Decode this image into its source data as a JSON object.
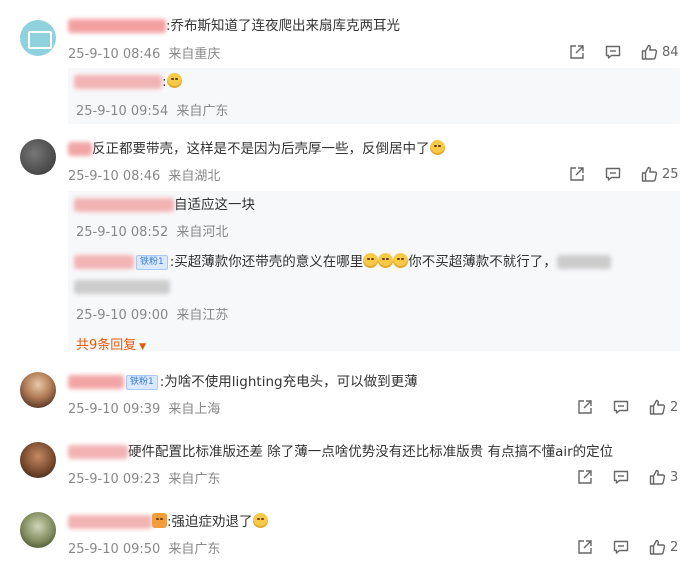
{
  "comments": [
    {
      "text": ":乔布斯知道了连夜爬出来扇库克两耳光",
      "time": "25-9-10 08:46",
      "location": "来自重庆",
      "likes": "84"
    },
    {
      "text": "反正都要带壳，这样是不是因为后壳厚一些，反倒居中了",
      "time": "25-9-10 08:46",
      "location": "来自湖北",
      "likes": "25"
    },
    {
      "badge": "铁粉1",
      "text": ":为啥不使用lighting充电头，可以做到更薄",
      "time": "25-9-10 09:39",
      "location": "来自上海",
      "likes": "2"
    },
    {
      "text": "硬件配置比标准版还差 除了薄一点啥优势没有还比标准版贵 有点搞不懂air的定位",
      "time": "25-9-10 09:23",
      "location": "来自广东",
      "likes": "3"
    },
    {
      "text": ":强迫症劝退了",
      "time": "25-9-10 09:50",
      "location": "来自广东",
      "likes": "2"
    }
  ],
  "replies": [
    {
      "text": ":",
      "time": "25-9-10 09:54",
      "location": "来自广东"
    },
    {
      "text": "自适应这一块",
      "time": "25-9-10 08:52",
      "location": "来自河北"
    },
    {
      "badge": "铁粉1",
      "text_a": ":买超薄款你还带壳的意义在哪里",
      "text_b": "你不买超薄款不就行了，",
      "time": "25-9-10 09:00",
      "location": "来自江苏"
    }
  ],
  "more_replies": "共9条回复",
  "icons": [
    "share-icon",
    "comment-icon",
    "like-icon",
    "caret-down-icon"
  ],
  "colors": {
    "accent": "#e8590c",
    "meta": "#888888",
    "badge": "#3a7bd5",
    "reply_bg": "#f7f8fa"
  }
}
